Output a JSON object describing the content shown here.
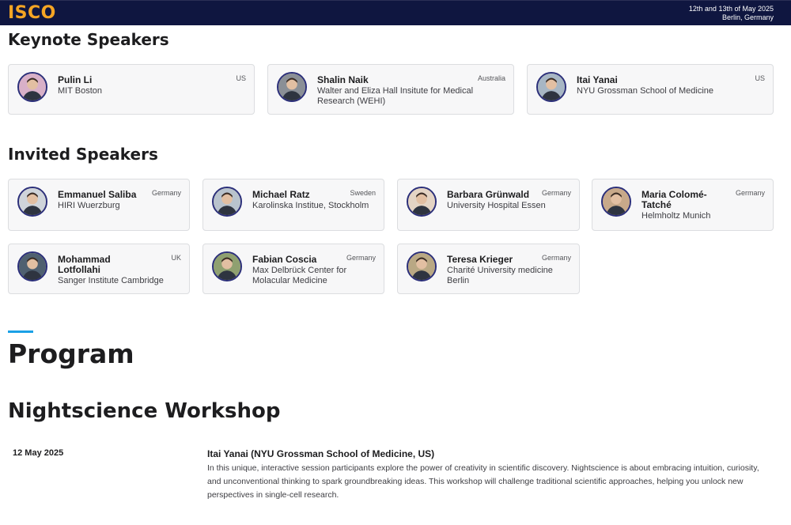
{
  "header": {
    "logo": "ISCO",
    "date_line": "12th and 13th of May 2025",
    "location_line": "Berlin, Germany"
  },
  "keynote": {
    "title": "Keynote Speakers",
    "speakers": [
      {
        "name": "Pulin Li",
        "affiliation": "MIT Boston",
        "country": "US",
        "avatar_bg": "#d8b0c8"
      },
      {
        "name": "Shalin Naik",
        "affiliation": "Walter and Eliza Hall Insitute for Medical Research (WEHI)",
        "country": "Australia",
        "avatar_bg": "#8a8f96"
      },
      {
        "name": "Itai Yanai",
        "affiliation": "NYU Grossman School of Medicine",
        "country": "US",
        "avatar_bg": "#a7b6c4"
      }
    ]
  },
  "invited": {
    "title": "Invited Speakers",
    "speakers": [
      {
        "name": "Emmanuel Saliba",
        "affiliation": "HIRI Wuerzburg",
        "country": "Germany",
        "avatar_bg": "#cfd4da"
      },
      {
        "name": "Michael Ratz",
        "affiliation": "Karolinska Institue, Stockholm",
        "country": "Sweden",
        "avatar_bg": "#b9c3cd"
      },
      {
        "name": "Barbara Grünwald",
        "affiliation": "University Hospital Essen",
        "country": "Germany",
        "avatar_bg": "#e4d4c4"
      },
      {
        "name": "Maria Colomé-Tatché",
        "affiliation": "Helmholtz Munich",
        "country": "Germany",
        "avatar_bg": "#c8a98a"
      },
      {
        "name": "Mohammad Lotfollahi",
        "affiliation": "Sanger Institute Cambridge",
        "country": "UK",
        "avatar_bg": "#4f6070"
      },
      {
        "name": "Fabian Coscia",
        "affiliation": "Max Delbrück Center for Molacular Medicine",
        "country": "Germany",
        "avatar_bg": "#8fa070"
      },
      {
        "name": "Teresa Krieger",
        "affiliation": "Charité University medicine Berlin",
        "country": "Germany",
        "avatar_bg": "#b9a884"
      }
    ]
  },
  "program": {
    "title": "Program",
    "workshop_title": "Nightscience Workshop",
    "session": {
      "date": "12 May 2025",
      "title": "Itai Yanai (NYU Grossman School of Medicine, US)",
      "description": "In this unique, interactive session participants explore the power of creativity in scientific discovery. Nightscience is about embracing intuition, curiosity, and unconventional thinking to spark groundbreaking ideas. This workshop will challenge traditional scientific approaches, helping you unlock new perspectives in single-cell research."
    }
  },
  "colors": {
    "header_bg": "#0f1640",
    "logo": "#f5a524",
    "accent": "#1aa0e6",
    "card_bg": "#f7f7f8",
    "avatar_ring": "#2b2f7a"
  }
}
